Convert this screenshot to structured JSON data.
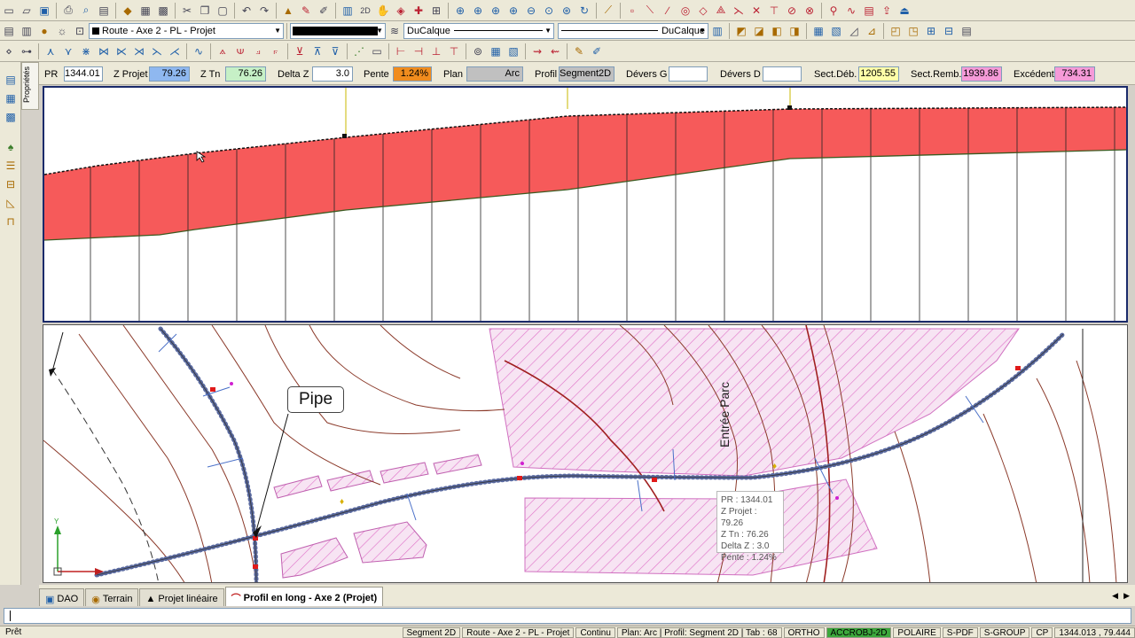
{
  "toolbar2": {
    "layer_combo": "Route - Axe 2 - PL - Projet",
    "linetype_combo": "DuCalque",
    "lineweight_combo": "DuCalque"
  },
  "props": {
    "pr_label": "PR",
    "pr_value": "1344.01",
    "zprojet_label": "Z Projet",
    "zprojet_value": "79.26",
    "ztn_label": "Z Tn",
    "ztn_value": "76.26",
    "deltaz_label": "Delta Z",
    "deltaz_value": "3.0",
    "pente_label": "Pente",
    "pente_value": "1.24%",
    "plan_label": "Plan",
    "plan_value": "Arc",
    "profil_label": "Profil",
    "profil_value": "Segment2D",
    "deversg_label": "Dévers G",
    "deversg_value": "",
    "deversd_label": "Dévers D",
    "deversd_value": "",
    "sectdeb_label": "Sect.Déb.",
    "sectdeb_value": "1205.55",
    "sectremb_label": "Sect.Remb.",
    "sectremb_value": "1939.86",
    "excedent_label": "Excédent",
    "excedent_value": "734.31",
    "colors": {
      "zprojet": "#8fb8f0",
      "ztn": "#c6f0c6",
      "pente": "#f08c1e",
      "plan": "#c0c0c0",
      "profil": "#c0c0c0",
      "sectdeb": "#ffffa8",
      "sectremb": "#f59ad8",
      "excedent": "#f59ad8"
    }
  },
  "side_tab": "Propriétés",
  "plan": {
    "pipe_label": "Pipe",
    "entree_label": "Entrée Parc",
    "tooltip": {
      "pr": "PR : 1344.01",
      "zprojet": "Z Projet : 79.26",
      "ztn": "Z Tn : 76.26",
      "deltaz": "Delta Z : 3.0",
      "pente": "Pente : 1.24%"
    }
  },
  "tabs": [
    {
      "label": "DAO"
    },
    {
      "label": "Terrain"
    },
    {
      "label": "Projet linéaire"
    },
    {
      "label": "Profil en long - Axe 2 (Projet)"
    }
  ],
  "status": {
    "left": "Prêt",
    "items": [
      "Segment 2D",
      "Route - Axe 2 - PL - Projet",
      "Continu",
      "Plan: Arc | Profil: Segment 2D | Tab : 68",
      "ORTHO",
      "ACCROBJ-2D",
      "POLAIRE",
      "S-PDF",
      "S-GROUP",
      "CP",
      "1344.013 , 79.444"
    ],
    "active_item": "ACCROBJ-2D"
  },
  "colors": {
    "fill": "#f65a5a",
    "hatch": "#e070c8",
    "contour": "#8b3a2a"
  }
}
